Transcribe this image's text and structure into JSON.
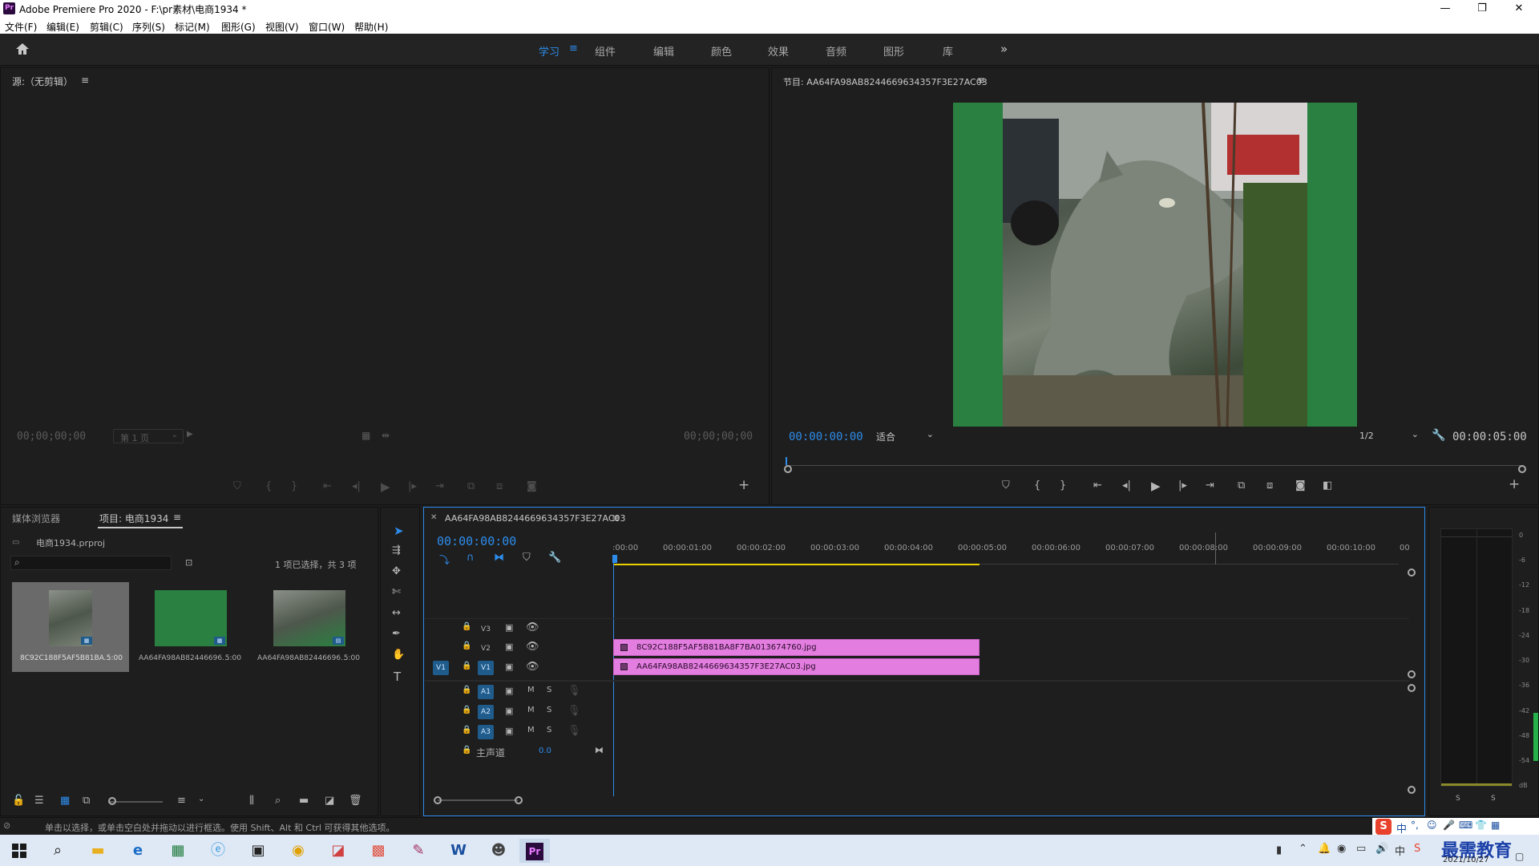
{
  "window": {
    "app_icon": "Pr",
    "title": "Adobe Premiere Pro 2020 - F:\\pr素材\\电商1934 *",
    "minimize": "—",
    "maximize": "❐",
    "close": "✕"
  },
  "menu": [
    "文件(F)",
    "编辑(E)",
    "剪辑(C)",
    "序列(S)",
    "标记(M)",
    "图形(G)",
    "视图(V)",
    "窗口(W)",
    "帮助(H)"
  ],
  "workspaces": {
    "items": [
      "学习",
      "组件",
      "编辑",
      "颜色",
      "效果",
      "音频",
      "图形",
      "库"
    ],
    "active": "学习",
    "more": "»"
  },
  "source": {
    "title": "源:（无剪辑）",
    "tc_left": "00;00;00;00",
    "page_select": "第 1 页",
    "tc_right": "00;00;00;00"
  },
  "program": {
    "title": "节目: AA64FA98AB8244669634357F3E27AC03",
    "tc": "00:00:00:00",
    "fit": "适合",
    "quality": "1/2",
    "duration": "00:00:05:00"
  },
  "project": {
    "tab_media": "媒体浏览器",
    "tab_project": "项目: 电商1934",
    "file": "电商1934.prproj",
    "selection": "1 项已选择，共 3 项",
    "items": [
      {
        "name": "8C92C188F5AF5B81BA...",
        "dur": "5:00"
      },
      {
        "name": "AA64FA98AB82446696...",
        "dur": "5:00"
      },
      {
        "name": "AA64FA98AB82446696...",
        "dur": "5:00"
      }
    ]
  },
  "timeline": {
    "tab": "AA64FA98AB8244669634357F3E27AC03",
    "tc": "00:00:00:00",
    "ruler": [
      ":00:00",
      "00:00:01:00",
      "00:00:02:00",
      "00:00:03:00",
      "00:00:04:00",
      "00:00:05:00",
      "00:00:06:00",
      "00:00:07:00",
      "00:00:08:00",
      "00:00:09:00",
      "00:00:10:00",
      "00"
    ],
    "video_tracks": [
      "V3",
      "V2",
      "V1"
    ],
    "audio_tracks": [
      "A1",
      "A2",
      "A3"
    ],
    "src_patch": "V1",
    "m": "M",
    "s": "S",
    "master_label": "主声道",
    "master_value": "0.0",
    "clips": [
      {
        "name": "8C92C188F5AF5B81BA8F7BA013674760.jpg",
        "track": "V2"
      },
      {
        "name": "AA64FA98AB8244669634357F3E27AC03.jpg",
        "track": "V1"
      }
    ]
  },
  "meter": {
    "labels": [
      "0",
      "-6",
      "-12",
      "-18",
      "-24",
      "-30",
      "-36",
      "-42",
      "-48",
      "-54",
      "dB"
    ],
    "solo_l": "S",
    "solo_r": "S"
  },
  "status": {
    "text": "单击以选择，或单击空白处并拖动以进行框选。使用 Shift、Alt 和 Ctrl 可获得其他选项。"
  },
  "ime": {
    "lang": "中"
  },
  "taskbar": {
    "date": "2021/10/27",
    "watermark": "最需教育"
  },
  "colors": {
    "accent": "#2d8ceb",
    "clip": "#e37ee0",
    "matte": "#2a8040",
    "work_area": "#e8d000"
  }
}
